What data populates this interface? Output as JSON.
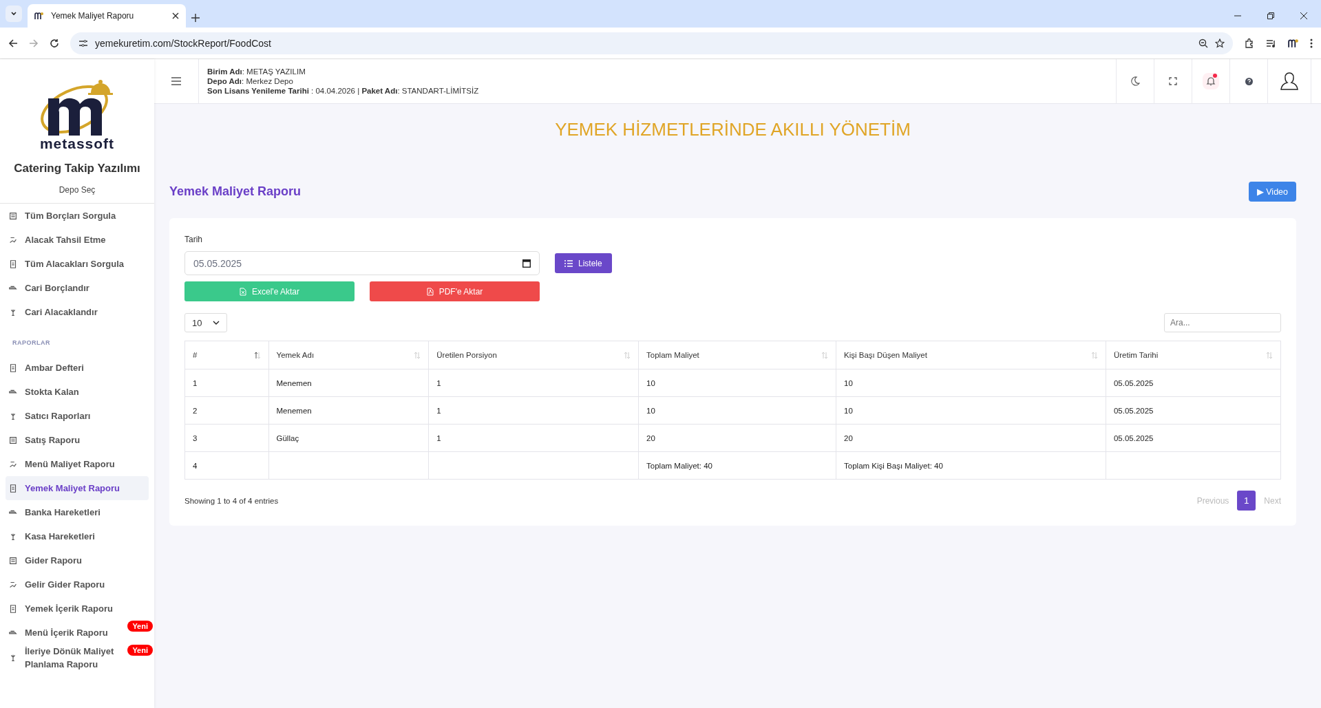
{
  "browser": {
    "tab_title": "Yemek Maliyet Raporu",
    "url": "yemekuretim.com/StockReport/FoodCost"
  },
  "sidebar": {
    "brand": "metassoft",
    "app_name": "Catering Takip Yazılımı",
    "depot_link": "Depo Seç",
    "items": [
      {
        "label": "Tüm Borçları Sorgula",
        "selected": false
      },
      {
        "label": "Alacak Tahsil Etme",
        "selected": false
      },
      {
        "label": "Tüm Alacakları Sorgula",
        "selected": false
      },
      {
        "label": "Cari Borçlandır",
        "selected": false
      },
      {
        "label": "Cari Alacaklandır",
        "selected": false
      }
    ],
    "section_title": "RAPORLAR",
    "report_items": [
      {
        "label": "Ambar Defteri",
        "selected": false
      },
      {
        "label": "Stokta Kalan",
        "selected": false
      },
      {
        "label": "Satıcı Raporları",
        "selected": false
      },
      {
        "label": "Satış Raporu",
        "selected": false
      },
      {
        "label": "Menü Maliyet Raporu",
        "selected": false
      },
      {
        "label": "Yemek Maliyet Raporu",
        "selected": true
      },
      {
        "label": "Banka Hareketleri",
        "selected": false
      },
      {
        "label": "Kasa Hareketleri",
        "selected": false
      },
      {
        "label": "Gider Raporu",
        "selected": false
      },
      {
        "label": "Gelir Gider Raporu",
        "selected": false
      },
      {
        "label": "Yemek İçerik Raporu",
        "selected": false
      },
      {
        "label": "Menü İçerik Raporu",
        "selected": false,
        "badge": "Yeni"
      },
      {
        "label": "İleriye Dönük Maliyet Planlama Raporu",
        "selected": false,
        "badge": "Yeni"
      }
    ]
  },
  "header": {
    "lines": [
      "**Birim Adı**: METAŞ YAZILIM",
      "**Depo Adı**: Merkez Depo",
      "**Son Lisans Yenileme Tarihi** : 04.04.2026 | **Paket Adı**: STANDART-LİMİTSİZ"
    ]
  },
  "banner": "YEMEK HİZMETLERİNDE AKILLI YÖNETİM",
  "page_title": "Yemek Maliyet Raporu",
  "video_button": "▶ Video",
  "form": {
    "date_label": "Tarih",
    "date_value": "05.05.2025",
    "list_button": "Listele",
    "excel_button": "Excel'e Aktar",
    "pdf_button": "PDF'e Aktar"
  },
  "table": {
    "page_size": "10",
    "search_placeholder": "Ara...",
    "columns": [
      {
        "label": "#",
        "sorted": true
      },
      {
        "label": "Yemek Adı",
        "sorted": false
      },
      {
        "label": "Üretilen Porsiyon",
        "sorted": false
      },
      {
        "label": "Toplam Maliyet",
        "sorted": false
      },
      {
        "label": "Kişi Başı Düşen Maliyet",
        "sorted": false
      },
      {
        "label": "Üretim Tarihi",
        "sorted": false
      }
    ],
    "rows": [
      [
        "1",
        "Menemen",
        "1",
        "10",
        "10",
        "05.05.2025"
      ],
      [
        "2",
        "Menemen",
        "1",
        "10",
        "10",
        "05.05.2025"
      ],
      [
        "3",
        "Güllaç",
        "1",
        "20",
        "20",
        "05.05.2025"
      ],
      [
        "4",
        "",
        "",
        "Toplam Maliyet: 40",
        "Toplam Kişi Başı Maliyet: 40",
        ""
      ]
    ],
    "info": "Showing 1 to 4 of 4 entries",
    "pagination": {
      "previous": "Previous",
      "pages": [
        {
          "label": "1",
          "selected": true
        }
      ],
      "next": "Next"
    }
  }
}
